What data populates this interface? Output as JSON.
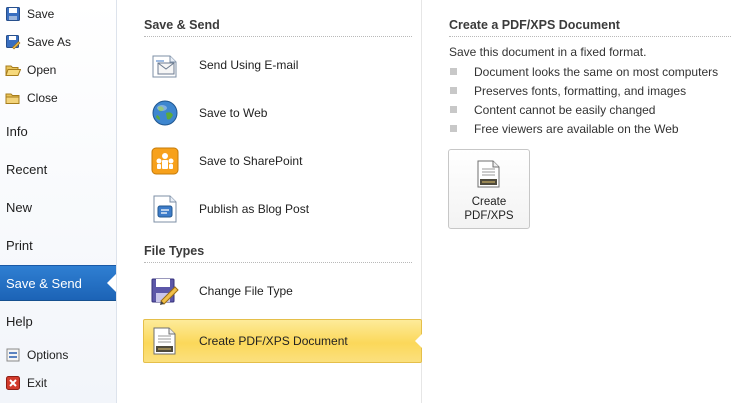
{
  "nav": {
    "save": "Save",
    "save_as": "Save As",
    "open": "Open",
    "close": "Close",
    "info": "Info",
    "recent": "Recent",
    "new": "New",
    "print": "Print",
    "save_send": "Save & Send",
    "help": "Help",
    "options": "Options",
    "exit": "Exit"
  },
  "middle": {
    "section1_title": "Save & Send",
    "section1_items": [
      {
        "label": "Send Using E-mail",
        "icon": "email-icon"
      },
      {
        "label": "Save to Web",
        "icon": "globe-icon"
      },
      {
        "label": "Save to SharePoint",
        "icon": "sharepoint-icon"
      },
      {
        "label": "Publish as Blog Post",
        "icon": "blog-icon"
      }
    ],
    "section2_title": "File Types",
    "section2_items": [
      {
        "label": "Change File Type",
        "icon": "change-file-type-icon"
      },
      {
        "label": "Create PDF/XPS Document",
        "icon": "pdf-document-icon",
        "selected": true
      }
    ]
  },
  "detail": {
    "title": "Create a PDF/XPS Document",
    "subtitle": "Save this document in a fixed format.",
    "bullets": [
      "Document looks the same on most computers",
      "Preserves fonts, formatting, and images",
      "Content cannot be easily changed",
      "Free viewers are available on the Web"
    ],
    "button_line1": "Create",
    "button_line2": "PDF/XPS"
  },
  "colors": {
    "active_tab": "#1c63b6",
    "selected_item": "#fbd85a",
    "selected_border": "#e5bf4a"
  }
}
